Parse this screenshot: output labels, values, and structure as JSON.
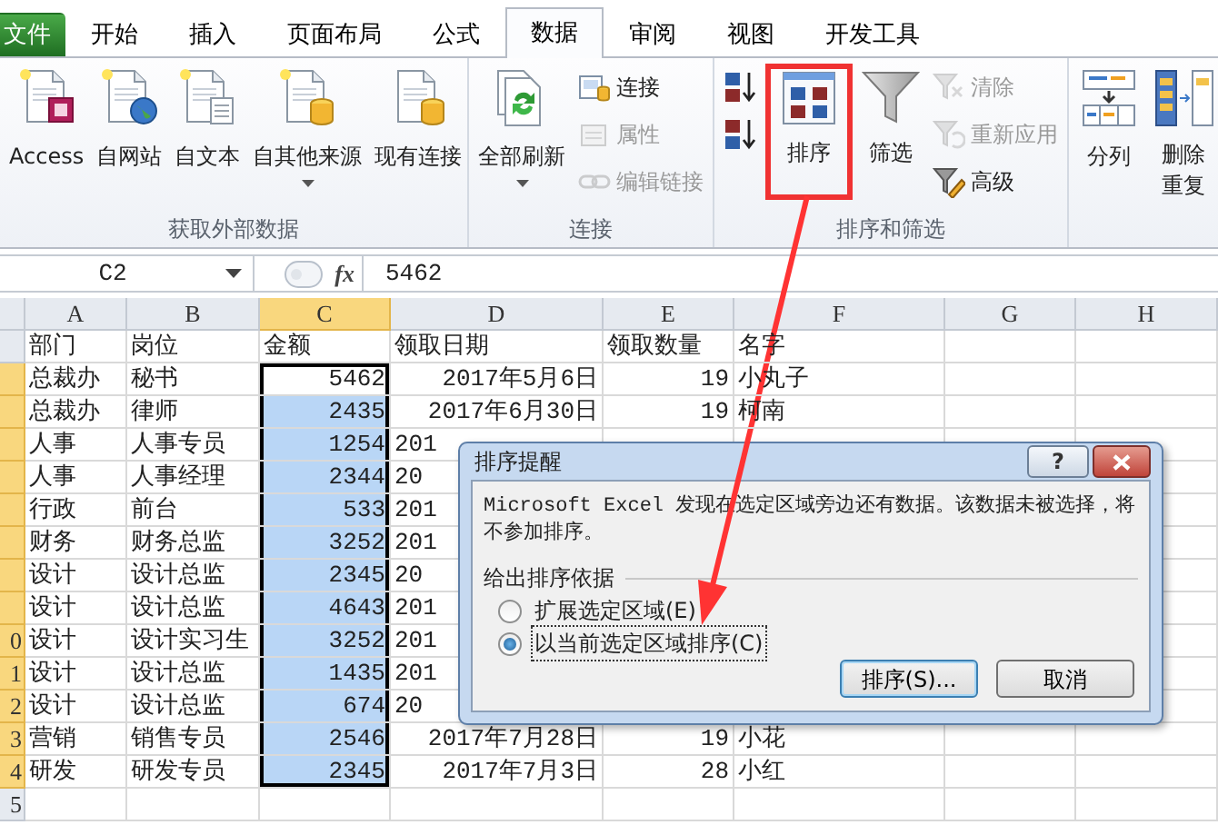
{
  "tabs": [
    {
      "label": "文件",
      "kind": "file",
      "selected": false
    },
    {
      "label": "开始",
      "kind": "tab",
      "selected": false
    },
    {
      "label": "插入",
      "kind": "tab",
      "selected": false
    },
    {
      "label": "页面布局",
      "kind": "tab",
      "selected": false
    },
    {
      "label": "公式",
      "kind": "tab",
      "selected": false
    },
    {
      "label": "数据",
      "kind": "tab",
      "selected": true
    },
    {
      "label": "审阅",
      "kind": "tab",
      "selected": false
    },
    {
      "label": "视图",
      "kind": "tab",
      "selected": false
    },
    {
      "label": "开发工具",
      "kind": "tab",
      "selected": false
    }
  ],
  "ribbon": {
    "groups": [
      {
        "label": "获取外部数据",
        "items": [
          {
            "label": "Access",
            "kind": "large",
            "disabled": false,
            "dropdown": false,
            "highlighted": false
          },
          {
            "label": "自网站",
            "kind": "large",
            "disabled": false,
            "dropdown": false,
            "highlighted": false
          },
          {
            "label": "自文本",
            "kind": "large",
            "disabled": false,
            "dropdown": false,
            "highlighted": false
          },
          {
            "label": "自其他来源",
            "kind": "large",
            "disabled": false,
            "dropdown": true,
            "highlighted": false
          },
          {
            "label": "现有连接",
            "kind": "large",
            "disabled": false,
            "dropdown": false,
            "highlighted": false
          }
        ]
      },
      {
        "label": "连接",
        "items": [
          {
            "label": "全部刷新",
            "kind": "large",
            "disabled": false,
            "dropdown": true,
            "highlighted": false
          },
          {
            "label": "连接",
            "kind": "small",
            "disabled": false,
            "dropdown": false,
            "highlighted": false
          },
          {
            "label": "属性",
            "kind": "small",
            "disabled": true,
            "dropdown": false,
            "highlighted": false
          },
          {
            "label": "编辑链接",
            "kind": "small",
            "disabled": true,
            "dropdown": false,
            "highlighted": false
          }
        ]
      },
      {
        "label": "排序和筛选",
        "items": [
          {
            "kind": "small",
            "disabled": false,
            "dropdown": false,
            "highlighted": false
          },
          {
            "kind": "small",
            "disabled": false,
            "dropdown": false,
            "highlighted": false
          },
          {
            "label": "排序",
            "kind": "large",
            "disabled": false,
            "dropdown": false,
            "highlighted": true
          },
          {
            "label": "筛选",
            "kind": "large",
            "disabled": false,
            "dropdown": false,
            "highlighted": false
          },
          {
            "label": "清除",
            "kind": "small",
            "disabled": true,
            "dropdown": false,
            "highlighted": false
          },
          {
            "label": "重新应用",
            "kind": "small",
            "disabled": true,
            "dropdown": false,
            "highlighted": false
          },
          {
            "label": "高级",
            "kind": "small",
            "disabled": false,
            "dropdown": false,
            "highlighted": false
          }
        ]
      },
      {
        "items": [
          {
            "label": "分列",
            "kind": "large",
            "disabled": false,
            "dropdown": false,
            "highlighted": false
          },
          {
            "label": "删除重复",
            "kind": "large",
            "disabled": false,
            "dropdown": false,
            "highlighted": false
          }
        ]
      }
    ]
  },
  "formula_bar": {
    "name_box": "C2",
    "function_label": "fx",
    "value": "5462"
  },
  "columns": [
    {
      "label": "A",
      "selected": false
    },
    {
      "label": "B",
      "selected": false
    },
    {
      "label": "C",
      "selected": true
    },
    {
      "label": "D",
      "selected": false
    },
    {
      "label": "E",
      "selected": false
    },
    {
      "label": "F",
      "selected": false
    },
    {
      "label": "G",
      "selected": false
    },
    {
      "label": "H",
      "selected": false
    }
  ],
  "rows": [
    {
      "selected": false,
      "cells": [
        {
          "text": "部门",
          "kind": "text",
          "selected": false
        },
        {
          "text": "岗位",
          "kind": "text",
          "selected": false
        },
        {
          "text": "金额",
          "kind": "text",
          "selected": false
        },
        {
          "text": "领取日期",
          "kind": "text",
          "selected": false
        },
        {
          "text": "领取数量",
          "kind": "text",
          "selected": false
        },
        {
          "text": "名字",
          "kind": "text",
          "selected": false
        }
      ]
    },
    {
      "selected": true,
      "cells": [
        {
          "text": "总裁办",
          "kind": "text",
          "selected": false
        },
        {
          "text": "秘书",
          "kind": "text",
          "selected": false
        },
        {
          "text": "5462",
          "kind": "number",
          "selected": true
        },
        {
          "text": "2017年5月6日",
          "kind": "number",
          "selected": false
        },
        {
          "text": "19",
          "kind": "number",
          "selected": false
        },
        {
          "text": "小丸子",
          "kind": "text",
          "selected": false
        }
      ]
    },
    {
      "selected": true,
      "cells": [
        {
          "text": "总裁办",
          "kind": "text",
          "selected": false
        },
        {
          "text": "律师",
          "kind": "text",
          "selected": false
        },
        {
          "text": "2435",
          "kind": "number",
          "selected": true
        },
        {
          "text": "2017年6月30日",
          "kind": "number",
          "selected": false
        },
        {
          "text": "19",
          "kind": "number",
          "selected": false
        },
        {
          "text": "柯南",
          "kind": "text",
          "selected": false
        }
      ]
    },
    {
      "selected": true,
      "cells": [
        {
          "text": "人事",
          "kind": "text",
          "selected": false
        },
        {
          "text": "人事专员",
          "kind": "text",
          "selected": false
        },
        {
          "text": "1254",
          "kind": "number",
          "selected": true
        },
        {
          "text": "201",
          "kind": "clipped",
          "selected": false
        }
      ]
    },
    {
      "selected": true,
      "cells": [
        {
          "text": "人事",
          "kind": "text",
          "selected": false
        },
        {
          "text": "人事经理",
          "kind": "text",
          "selected": false
        },
        {
          "text": "2344",
          "kind": "number",
          "selected": true
        },
        {
          "text": "20",
          "kind": "clipped",
          "selected": false
        }
      ]
    },
    {
      "selected": true,
      "cells": [
        {
          "text": "行政",
          "kind": "text",
          "selected": false
        },
        {
          "text": "前台",
          "kind": "text",
          "selected": false
        },
        {
          "text": "533",
          "kind": "number",
          "selected": true
        },
        {
          "text": "201",
          "kind": "clipped",
          "selected": false
        }
      ]
    },
    {
      "selected": true,
      "cells": [
        {
          "text": "财务",
          "kind": "text",
          "selected": false
        },
        {
          "text": "财务总监",
          "kind": "text",
          "selected": false
        },
        {
          "text": "3252",
          "kind": "number",
          "selected": true
        },
        {
          "text": "201",
          "kind": "clipped",
          "selected": false
        }
      ]
    },
    {
      "selected": true,
      "cells": [
        {
          "text": "设计",
          "kind": "text",
          "selected": false
        },
        {
          "text": "设计总监",
          "kind": "text",
          "selected": false
        },
        {
          "text": "2345",
          "kind": "number",
          "selected": true
        },
        {
          "text": "20",
          "kind": "clipped",
          "selected": false
        }
      ]
    },
    {
      "selected": true,
      "cells": [
        {
          "text": "设计",
          "kind": "text",
          "selected": false
        },
        {
          "text": "设计总监",
          "kind": "text",
          "selected": false
        },
        {
          "text": "4643",
          "kind": "number",
          "selected": true
        },
        {
          "text": "201",
          "kind": "clipped",
          "selected": false
        }
      ]
    },
    {
      "header": "0",
      "selected": true,
      "cells": [
        {
          "text": "设计",
          "kind": "text",
          "selected": false
        },
        {
          "text": "设计实习生",
          "kind": "text",
          "selected": false
        },
        {
          "text": "3252",
          "kind": "number",
          "selected": true
        },
        {
          "text": "201",
          "kind": "clipped",
          "selected": false
        }
      ]
    },
    {
      "header": "1",
      "selected": true,
      "cells": [
        {
          "text": "设计",
          "kind": "text",
          "selected": false
        },
        {
          "text": "设计总监",
          "kind": "text",
          "selected": false
        },
        {
          "text": "1435",
          "kind": "number",
          "selected": true
        },
        {
          "text": "201",
          "kind": "clipped",
          "selected": false
        }
      ]
    },
    {
      "header": "2",
      "selected": true,
      "cells": [
        {
          "text": "设计",
          "kind": "text",
          "selected": false
        },
        {
          "text": "设计总监",
          "kind": "text",
          "selected": false
        },
        {
          "text": "674",
          "kind": "number",
          "selected": true
        },
        {
          "text": "20",
          "kind": "clipped",
          "selected": false
        }
      ]
    },
    {
      "header": "3",
      "selected": true,
      "cells": [
        {
          "text": "营销",
          "kind": "text",
          "selected": false
        },
        {
          "text": "销售专员",
          "kind": "text",
          "selected": false
        },
        {
          "text": "2546",
          "kind": "number",
          "selected": true
        },
        {
          "text": "2017年7月28日",
          "kind": "number",
          "selected": false
        },
        {
          "text": "19",
          "kind": "number",
          "selected": false
        },
        {
          "text": "小花",
          "kind": "text",
          "selected": false
        }
      ]
    },
    {
      "header": "4",
      "selected": true,
      "cells": [
        {
          "text": "研发",
          "kind": "text",
          "selected": false
        },
        {
          "text": "研发专员",
          "kind": "text",
          "selected": false
        },
        {
          "text": "2345",
          "kind": "number",
          "selected": true
        },
        {
          "text": "2017年7月3日",
          "kind": "number",
          "selected": false
        },
        {
          "text": "28",
          "kind": "number",
          "selected": false
        },
        {
          "text": "小红",
          "kind": "text",
          "selected": false
        }
      ]
    },
    {
      "header": "5",
      "selected": false,
      "cells": []
    }
  ],
  "dialog": {
    "title": "排序提醒",
    "help_label": "?",
    "message": "Microsoft Excel 发现在选定区域旁边还有数据。该数据未被选择，将不参加排序。",
    "group_label": "给出排序依据",
    "options": [
      {
        "label": "扩展选定区域(E)",
        "selected": false
      },
      {
        "label": "以当前选定区域排序(C)",
        "selected": true
      }
    ],
    "buttons": [
      {
        "label": "排序(S)...",
        "kind": "default"
      },
      {
        "label": "取消",
        "kind": "normal"
      }
    ]
  },
  "pointer_arrow": true
}
